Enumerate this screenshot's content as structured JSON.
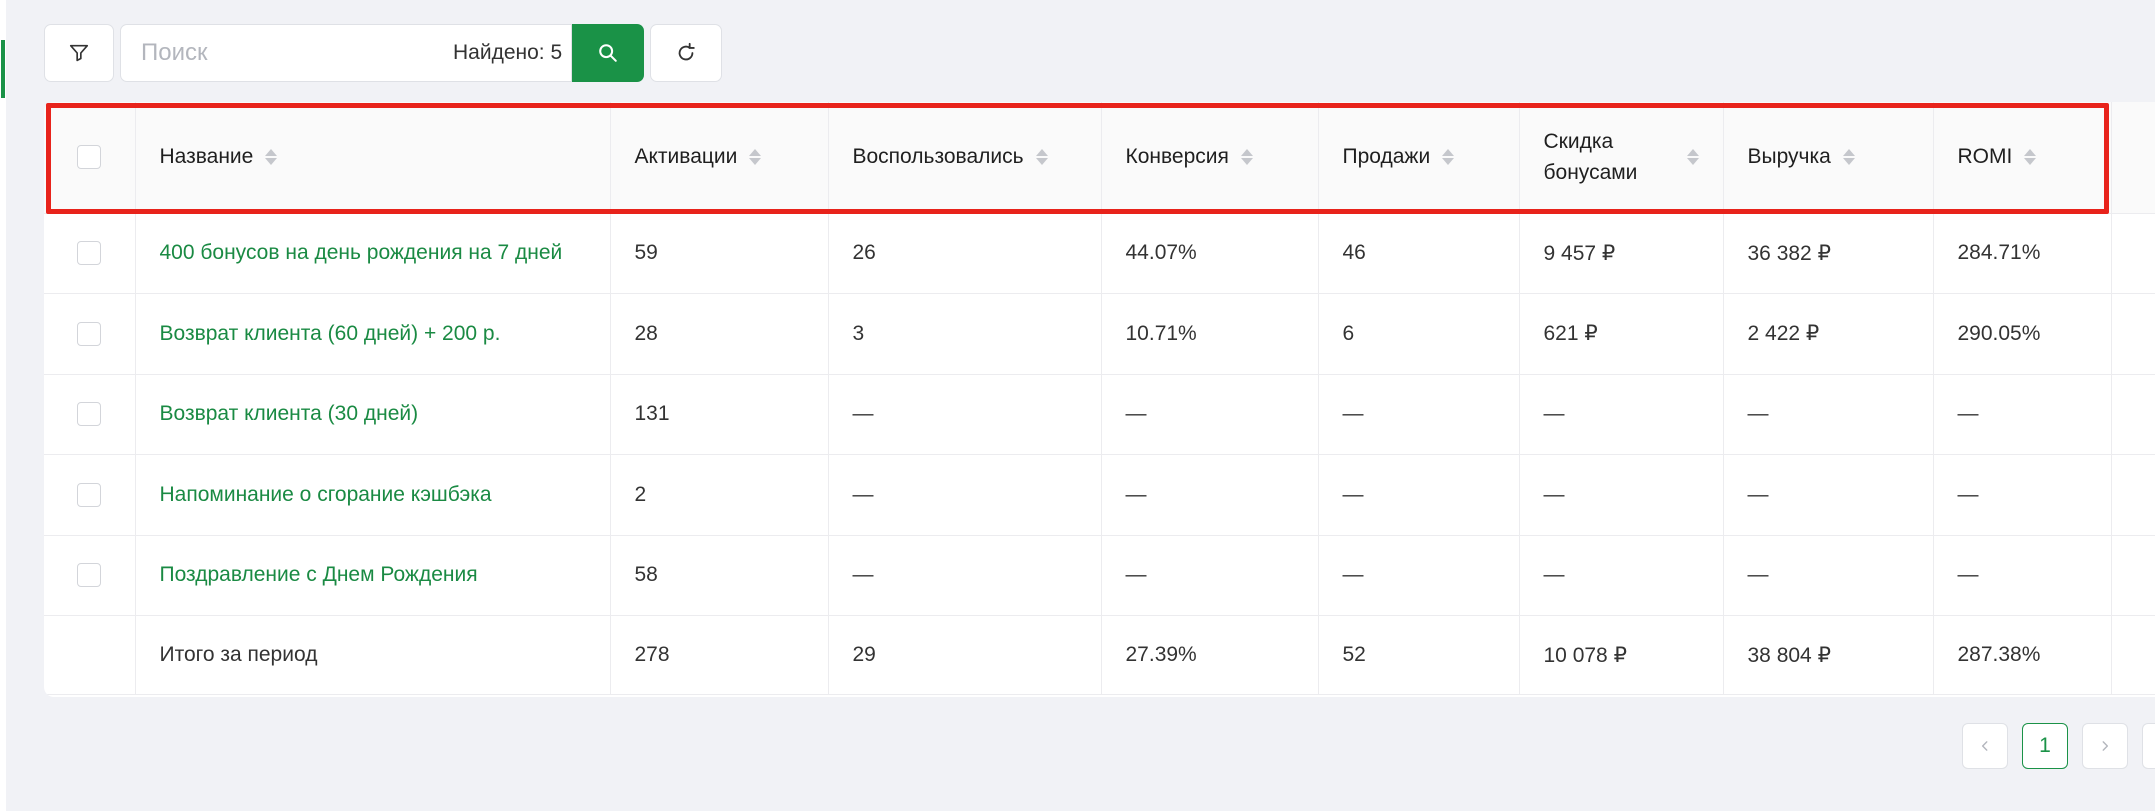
{
  "toolbar": {
    "search_placeholder": "Поиск",
    "found_text": "Найдено: 5"
  },
  "table": {
    "columns": [
      "Название",
      "Активации",
      "Воспользовались",
      "Конверсия",
      "Продажи",
      "Скидка бонусами",
      "Выручка",
      "ROMI"
    ],
    "rows": [
      {
        "name": "400 бонусов на день рождения на 7 дней",
        "activations": "59",
        "used": "26",
        "conversion": "44.07%",
        "sales": "46",
        "discount": "9 457 ₽",
        "revenue": "36 382 ₽",
        "romi": "284.71%"
      },
      {
        "name": "Возврат клиента (60 дней) + 200 р.",
        "activations": "28",
        "used": "3",
        "conversion": "10.71%",
        "sales": "6",
        "discount": "621 ₽",
        "revenue": "2 422 ₽",
        "romi": "290.05%"
      },
      {
        "name": "Возврат клиента (30 дней)",
        "activations": "131",
        "used": "—",
        "conversion": "—",
        "sales": "—",
        "discount": "—",
        "revenue": "—",
        "romi": "—"
      },
      {
        "name": "Напоминание о сгорание кэшбэка",
        "activations": "2",
        "used": "—",
        "conversion": "—",
        "sales": "—",
        "discount": "—",
        "revenue": "—",
        "romi": "—"
      },
      {
        "name": "Поздравление с Днем Рождения",
        "activations": "58",
        "used": "—",
        "conversion": "—",
        "sales": "—",
        "discount": "—",
        "revenue": "—",
        "romi": "—"
      }
    ],
    "total": {
      "name": "Итого за период",
      "activations": "278",
      "used": "29",
      "conversion": "27.39%",
      "sales": "52",
      "discount": "10 078 ₽",
      "revenue": "38 804 ₽",
      "romi": "287.38%"
    }
  },
  "pagination": {
    "current_page": "1"
  },
  "colors": {
    "accent": "#1a9247",
    "link": "#1a8a43",
    "highlight": "#e8231b"
  }
}
